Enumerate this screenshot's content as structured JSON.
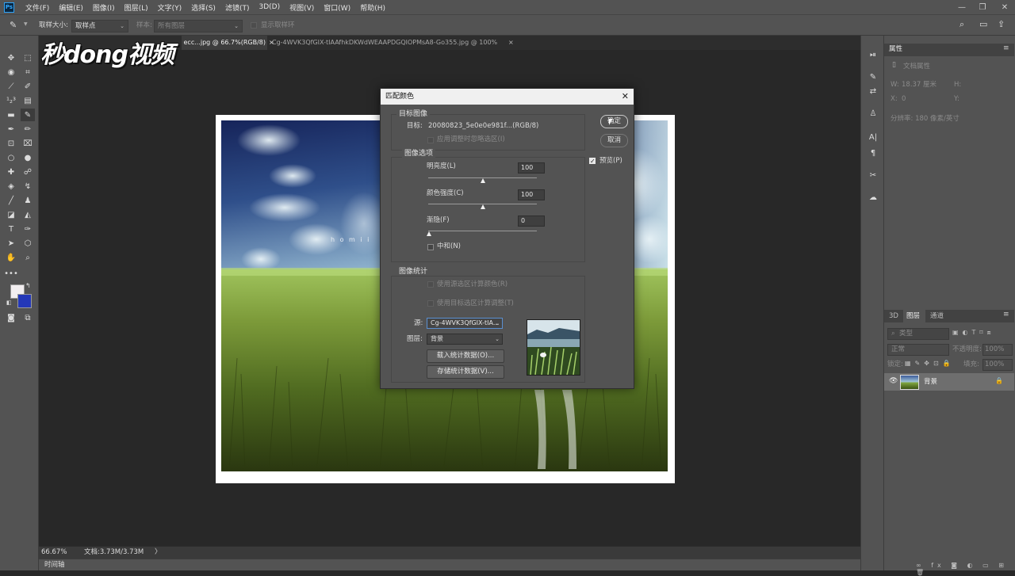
{
  "app": {
    "logo_text": "Ps"
  },
  "menu": [
    "文件(F)",
    "编辑(E)",
    "图像(I)",
    "图层(L)",
    "文字(Y)",
    "选择(S)",
    "滤镜(T)",
    "3D(D)",
    "视图(V)",
    "窗口(W)",
    "帮助(H)"
  ],
  "options_bar": {
    "sample_size_label": "取样大小:",
    "sample_size_value": "取样点",
    "sample_label": "样本:",
    "sample_value": "所有图层",
    "show_ring_label": "显示取样环"
  },
  "tabs": [
    {
      "label": "31f482ecc...jpg @ 66.7%(RGB/8) *",
      "active": true
    },
    {
      "label": "Cg-4WVK3QfGIX-tIAAfhkDKWdWEAAPDGQIOPMsA8-Go355.jpg @ 100%(RGB/8#)",
      "active": false
    }
  ],
  "watermark": "秒dong视频",
  "photo_overlay_text": "h o m i i",
  "dialog": {
    "title": "匹配颜色",
    "target_section": "目标图像",
    "target_label": "目标:",
    "target_value": "20080823_5e0e0e981f...(RGB/8)",
    "ignore_selection": "应用调整时忽略选区(I)",
    "options_section": "图像选项",
    "luminance_label": "明亮度(L)",
    "luminance_value": "100",
    "color_intensity_label": "颜色强度(C)",
    "color_intensity_value": "100",
    "fade_label": "渐隐(F)",
    "fade_value": "0",
    "neutralize_label": "中和(N)",
    "stats_section": "图像统计",
    "use_source_selection": "使用源选区计算颜色(R)",
    "use_target_selection": "使用目标选区计算调整(T)",
    "source_label": "源:",
    "source_value": "Cg-4WVK3QfGIX-tIA...",
    "layer_label": "图层:",
    "layer_value": "背景",
    "load_stats": "载入统计数据(O)...",
    "save_stats": "存储统计数据(V)...",
    "ok": "确定",
    "cancel": "取消",
    "preview": "预览(P)"
  },
  "properties_panel": {
    "title": "属性",
    "doc_props": "文档属性",
    "w_label": "W:",
    "w_value": "18.37 厘米",
    "h_label": "H:",
    "x_label": "X:",
    "x_value": "0",
    "y_label": "Y:",
    "resolution": "分辨率: 180 像素/英寸"
  },
  "layers_panel": {
    "tabs": [
      "3D",
      "图层",
      "通道"
    ],
    "search_placeholder": "类型",
    "blend_mode": "正常",
    "opacity_label": "不透明度:",
    "opacity_value": "100%",
    "lock_label": "锁定:",
    "fill_label": "填充:",
    "fill_value": "100%",
    "layer_name": "背景"
  },
  "status": {
    "zoom": "66.67%",
    "doc_size": "文档:3.73M/3.73M",
    "arrow": "〉"
  },
  "timeline_label": "时间轴",
  "colors": {
    "foreground": "#f2eef0",
    "background": "#2438b8"
  }
}
